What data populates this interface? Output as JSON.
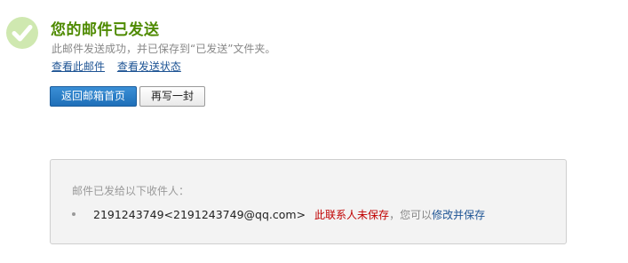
{
  "result": {
    "title": "您的邮件已发送",
    "subtitle": "此邮件发送成功，并已保存到“已发送”文件夹。",
    "links": {
      "view_mail": "查看此邮件",
      "view_status": "查看发送状态"
    }
  },
  "buttons": {
    "back_to_inbox": "返回邮箱首页",
    "write_another": "再写一封"
  },
  "recipients": {
    "heading": "邮件已发给以下收件人：",
    "items": [
      {
        "address": "2191243749<2191243749@qq.com>",
        "status": "此联系人未保存",
        "hint": "，您可以",
        "action": "修改并保存"
      }
    ]
  },
  "icons": {
    "success": "check-circle-icon"
  },
  "colors": {
    "title": "#4e8a00",
    "primary_button": "#2a7dc6",
    "link": "#1e5494",
    "warning": "#c00000",
    "success_icon": "#c8e6a8"
  }
}
